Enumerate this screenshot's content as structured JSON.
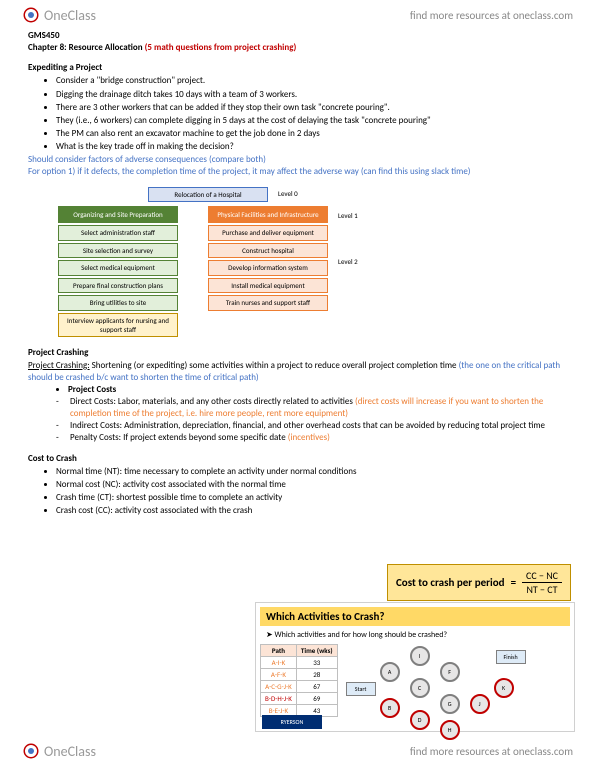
{
  "brand": "OneClass",
  "header_link": "find more resources at oneclass.com",
  "footer_link": "find more resources at oneclass.com",
  "course": "GMS450",
  "chapter_label": "Chapter 8: Resource Allocation",
  "chapter_note": "(5 math questions from project crashing)",
  "expediting": {
    "title": "Expediting a Project",
    "bullets": [
      "Consider a \"bridge construction\" project.",
      "Digging the drainage ditch takes 10 days with a team of 3 workers.",
      "There are 3 other workers that can be added if they stop their own task \"concrete pouring\".",
      "They (i.e., 6 workers) can complete digging in 5 days at the cost of delaying the task \"concrete pouring\"",
      "The PM can also rent an excavator machine to get the job done in 2 days",
      "What is the key trade off in making the decision?"
    ],
    "note1": "Should consider factors of adverse consequences (compare both)",
    "note2": "For option 1) if it defects, the completion time of the project, it may affect the adverse way (can find this using slack time)"
  },
  "diagram": {
    "top": "Relocation of a Hospital",
    "level0": "Level 0",
    "level1": "Level 1",
    "level2": "Level 2",
    "col1_head": "Organizing and Site Preparation",
    "col2_head": "Physical Facilities and Infrastructure",
    "col1_items": [
      "Select administration staff",
      "Site selection and survey",
      "Select medical equipment",
      "Prepare final construction plans",
      "Bring utilities to site",
      "Interview applicants for nursing and support staff"
    ],
    "col2_items": [
      "Purchase and deliver equipment",
      "Construct hospital",
      "Develop information system",
      "Install medical equipment",
      "Train nurses and support staff"
    ]
  },
  "crashing": {
    "title": "Project Crashing",
    "def_label": "Project Crashing:",
    "def_text": "Shortening (or expediting) some activities within a project to reduce overall project completion time",
    "def_note": "(the one on the critical path should be crashed b/c want to shorten the time of critical path)",
    "costs_head": "Project Costs",
    "direct": "Direct Costs: Labor, materials, and any other costs directly related to activities",
    "direct_note": "(direct costs will increase if you want to shorten the completion time of the project, i.e. hire more people, rent more equipment)",
    "indirect": "Indirect Costs: Administration, depreciation, financial, and other overhead costs that can be avoided by reducing total project time",
    "penalty": "Penalty Costs: If project extends beyond some specific date",
    "penalty_note": "(incentives)"
  },
  "cost_to_crash": {
    "title": "Cost to Crash",
    "items": [
      "Normal time (NT): time necessary to complete an activity under normal conditions",
      "Normal cost (NC): activity cost associated with the normal time",
      "Crash time (CT): shortest possible time to complete an activity",
      "Crash cost (CC): activity cost associated with the crash"
    ]
  },
  "formula": {
    "label": "Cost to crash per period",
    "eq": "=",
    "num": "CC − NC",
    "den": "NT − CT"
  },
  "crash_panel": {
    "title": "Which Activities to Crash?",
    "sub": "Which activities and for how long should be crashed?",
    "table_head": [
      "Path",
      "Time (wks)"
    ],
    "rows": [
      [
        "A-I-K",
        "33"
      ],
      [
        "A-F-K",
        "28"
      ],
      [
        "A-C-G-J-K",
        "67"
      ],
      [
        "B-D-H-J-K",
        "69"
      ],
      [
        "B-E-J-K",
        "43"
      ]
    ],
    "start": "Start",
    "finish": "Finish",
    "ryerson": "RYERSON"
  }
}
